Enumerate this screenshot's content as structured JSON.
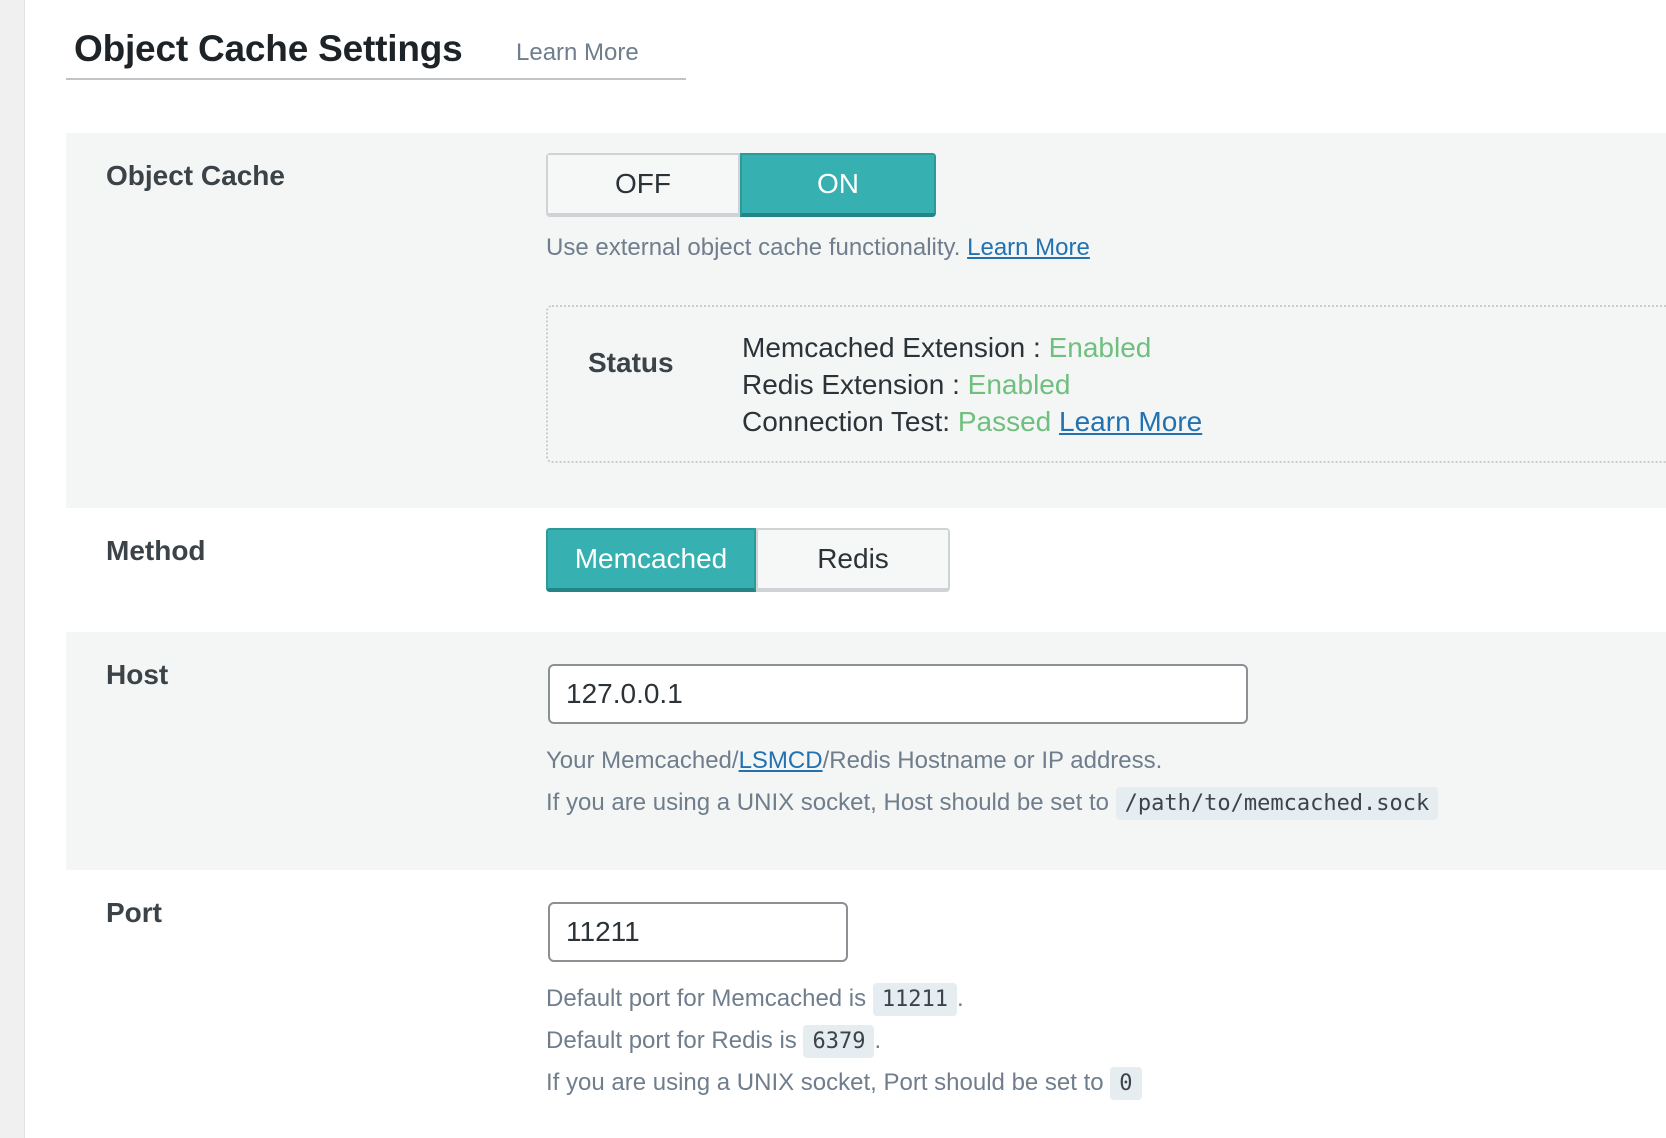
{
  "page": {
    "title": "Object Cache Settings",
    "title_learn_more": "Learn More"
  },
  "object_cache": {
    "label": "Object Cache",
    "toggle": {
      "off_label": "OFF",
      "on_label": "ON",
      "selected": "ON"
    },
    "description": "Use external object cache functionality.",
    "learn_more": "Learn More",
    "status": {
      "label": "Status",
      "memcached_label": "Memcached Extension :",
      "memcached_value": "Enabled",
      "redis_label": "Redis Extension :",
      "redis_value": "Enabled",
      "connection_label": "Connection Test:",
      "connection_value": "Passed",
      "learn_more": "Learn More"
    }
  },
  "method": {
    "label": "Method",
    "options": [
      "Memcached",
      "Redis"
    ],
    "selected": "Memcached"
  },
  "host": {
    "label": "Host",
    "value": "127.0.0.1",
    "desc_line1_prefix": "Your Memcached/",
    "desc_line1_link": "LSMCD",
    "desc_line1_suffix": "/Redis Hostname or IP address.",
    "desc_line2_prefix": "If you are using a UNIX socket, Host should be set to",
    "desc_line2_code": "/path/to/memcached.sock"
  },
  "port": {
    "label": "Port",
    "value": "11211",
    "desc_line1_prefix": "Default port for Memcached is",
    "desc_line1_code": "11211",
    "desc_line2_prefix": "Default port for Redis is",
    "desc_line2_code": "6379",
    "desc_line3_prefix": "If you are using a UNIX socket, Port should be set to",
    "desc_line3_code": "0",
    "period": "."
  },
  "colors": {
    "accent": "#36b0b0",
    "status_ok": "#6fbf7f",
    "link": "#2271b1",
    "description": "#6f7d8c"
  }
}
